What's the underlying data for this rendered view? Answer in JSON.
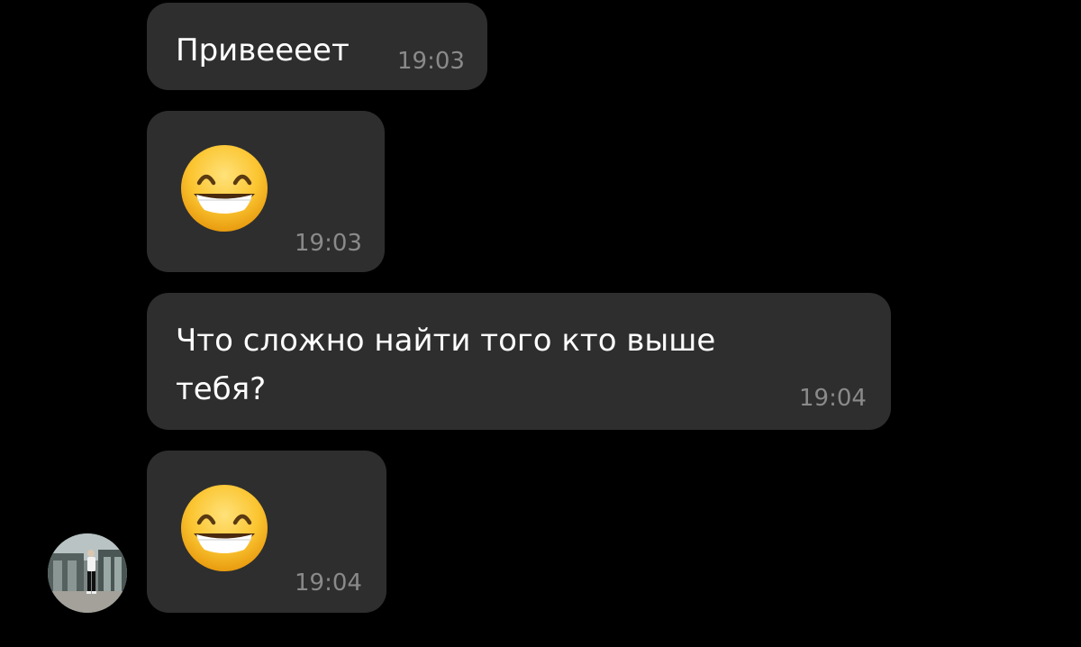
{
  "messages": [
    {
      "text": "Привеееет",
      "time": "19:03"
    },
    {
      "emoji": "grinning-face-with-smiling-eyes",
      "time": "19:03"
    },
    {
      "text_line1": "Что сложно найти того кто выше",
      "text_line2": "тебя?",
      "time": "19:04"
    },
    {
      "emoji": "grinning-face-with-smiling-eyes",
      "time": "19:04"
    }
  ],
  "colors": {
    "background": "#000000",
    "bubble": "#2e2e2e",
    "text": "#ffffff",
    "time": "#8a8a8a"
  }
}
